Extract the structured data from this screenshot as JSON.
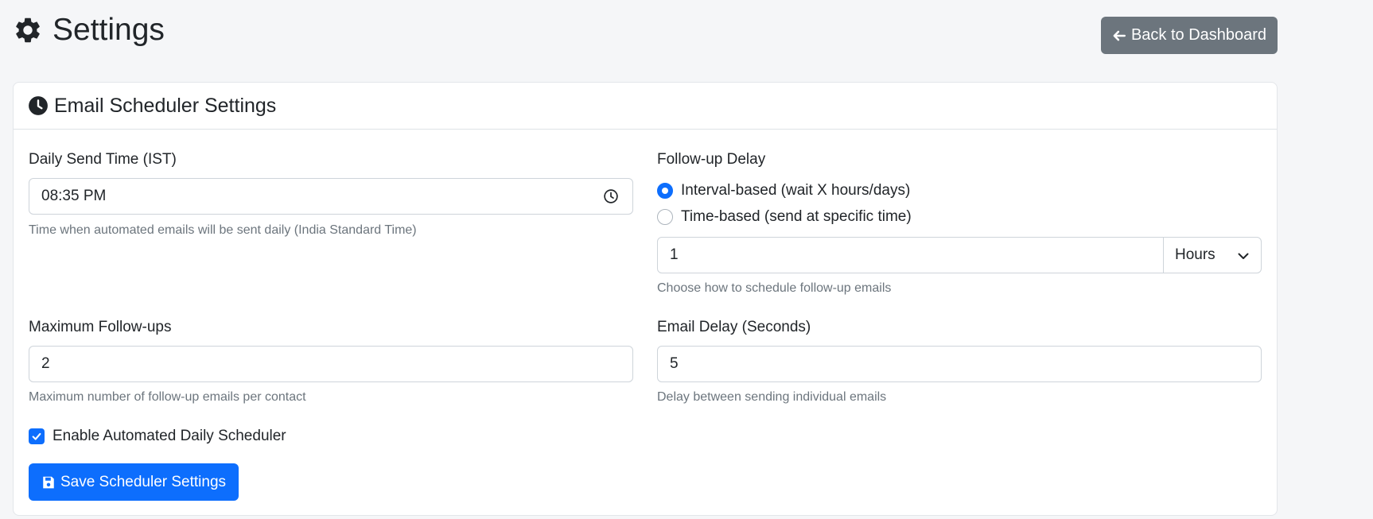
{
  "header": {
    "title": "Settings",
    "icon": "gear-icon",
    "back_button_label": "Back to Dashboard"
  },
  "card": {
    "title": "Email Scheduler Settings",
    "icon": "clock-icon"
  },
  "daily_send_time": {
    "label": "Daily Send Time (IST)",
    "value": "08:35 PM",
    "help": "Time when automated emails will be sent daily (India Standard Time)"
  },
  "follow_up_delay": {
    "label": "Follow-up Delay",
    "options": [
      {
        "label": "Interval-based (wait X hours/days)",
        "selected": true
      },
      {
        "label": "Time-based (send at specific time)",
        "selected": false
      }
    ],
    "value": "1",
    "unit": "Hours",
    "help": "Choose how to schedule follow-up emails"
  },
  "max_follow_ups": {
    "label": "Maximum Follow-ups",
    "value": "2",
    "help": "Maximum number of follow-up emails per contact"
  },
  "email_delay": {
    "label": "Email Delay (Seconds)",
    "value": "5",
    "help": "Delay between sending individual emails"
  },
  "enable_scheduler": {
    "label": "Enable Automated Daily Scheduler",
    "checked": true
  },
  "save_button_label": "Save Scheduler Settings",
  "colors": {
    "primary": "#0d6efd",
    "secondary": "#6c757d",
    "background": "#f5f6f8"
  }
}
